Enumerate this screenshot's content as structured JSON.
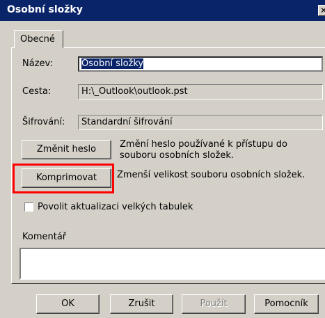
{
  "window": {
    "title": "Osobní složky",
    "close_glyph": "✕"
  },
  "tabs": [
    {
      "label": "Obecné"
    }
  ],
  "form": {
    "name_label": "Název:",
    "name_value": "Osobní složky",
    "path_label": "Cesta:",
    "path_value": "H:\\_Outlook\\outlook.pst",
    "encryption_label": "Šifrování:",
    "encryption_value": "Standardní šifrování"
  },
  "actions": {
    "change_password_label": "Změnit heslo",
    "change_password_desc_1": "Změní heslo používané k přístupu do",
    "change_password_desc_2": "souboru osobních složek.",
    "compact_label": "Komprimovat",
    "compact_desc": "Zmenší velikost souboru osobních složek."
  },
  "checkbox": {
    "label": "Povolit aktualizaci velkých tabulek",
    "checked": false
  },
  "comment": {
    "label": "Komentář",
    "value": ""
  },
  "footer": {
    "ok": "OK",
    "cancel": "Zrušit",
    "apply": "Použít",
    "help": "Pomocník"
  },
  "colors": {
    "titlebar": "#0a246a",
    "dialog_bg": "#d4d0c8",
    "highlight_box": "#ff0000"
  }
}
